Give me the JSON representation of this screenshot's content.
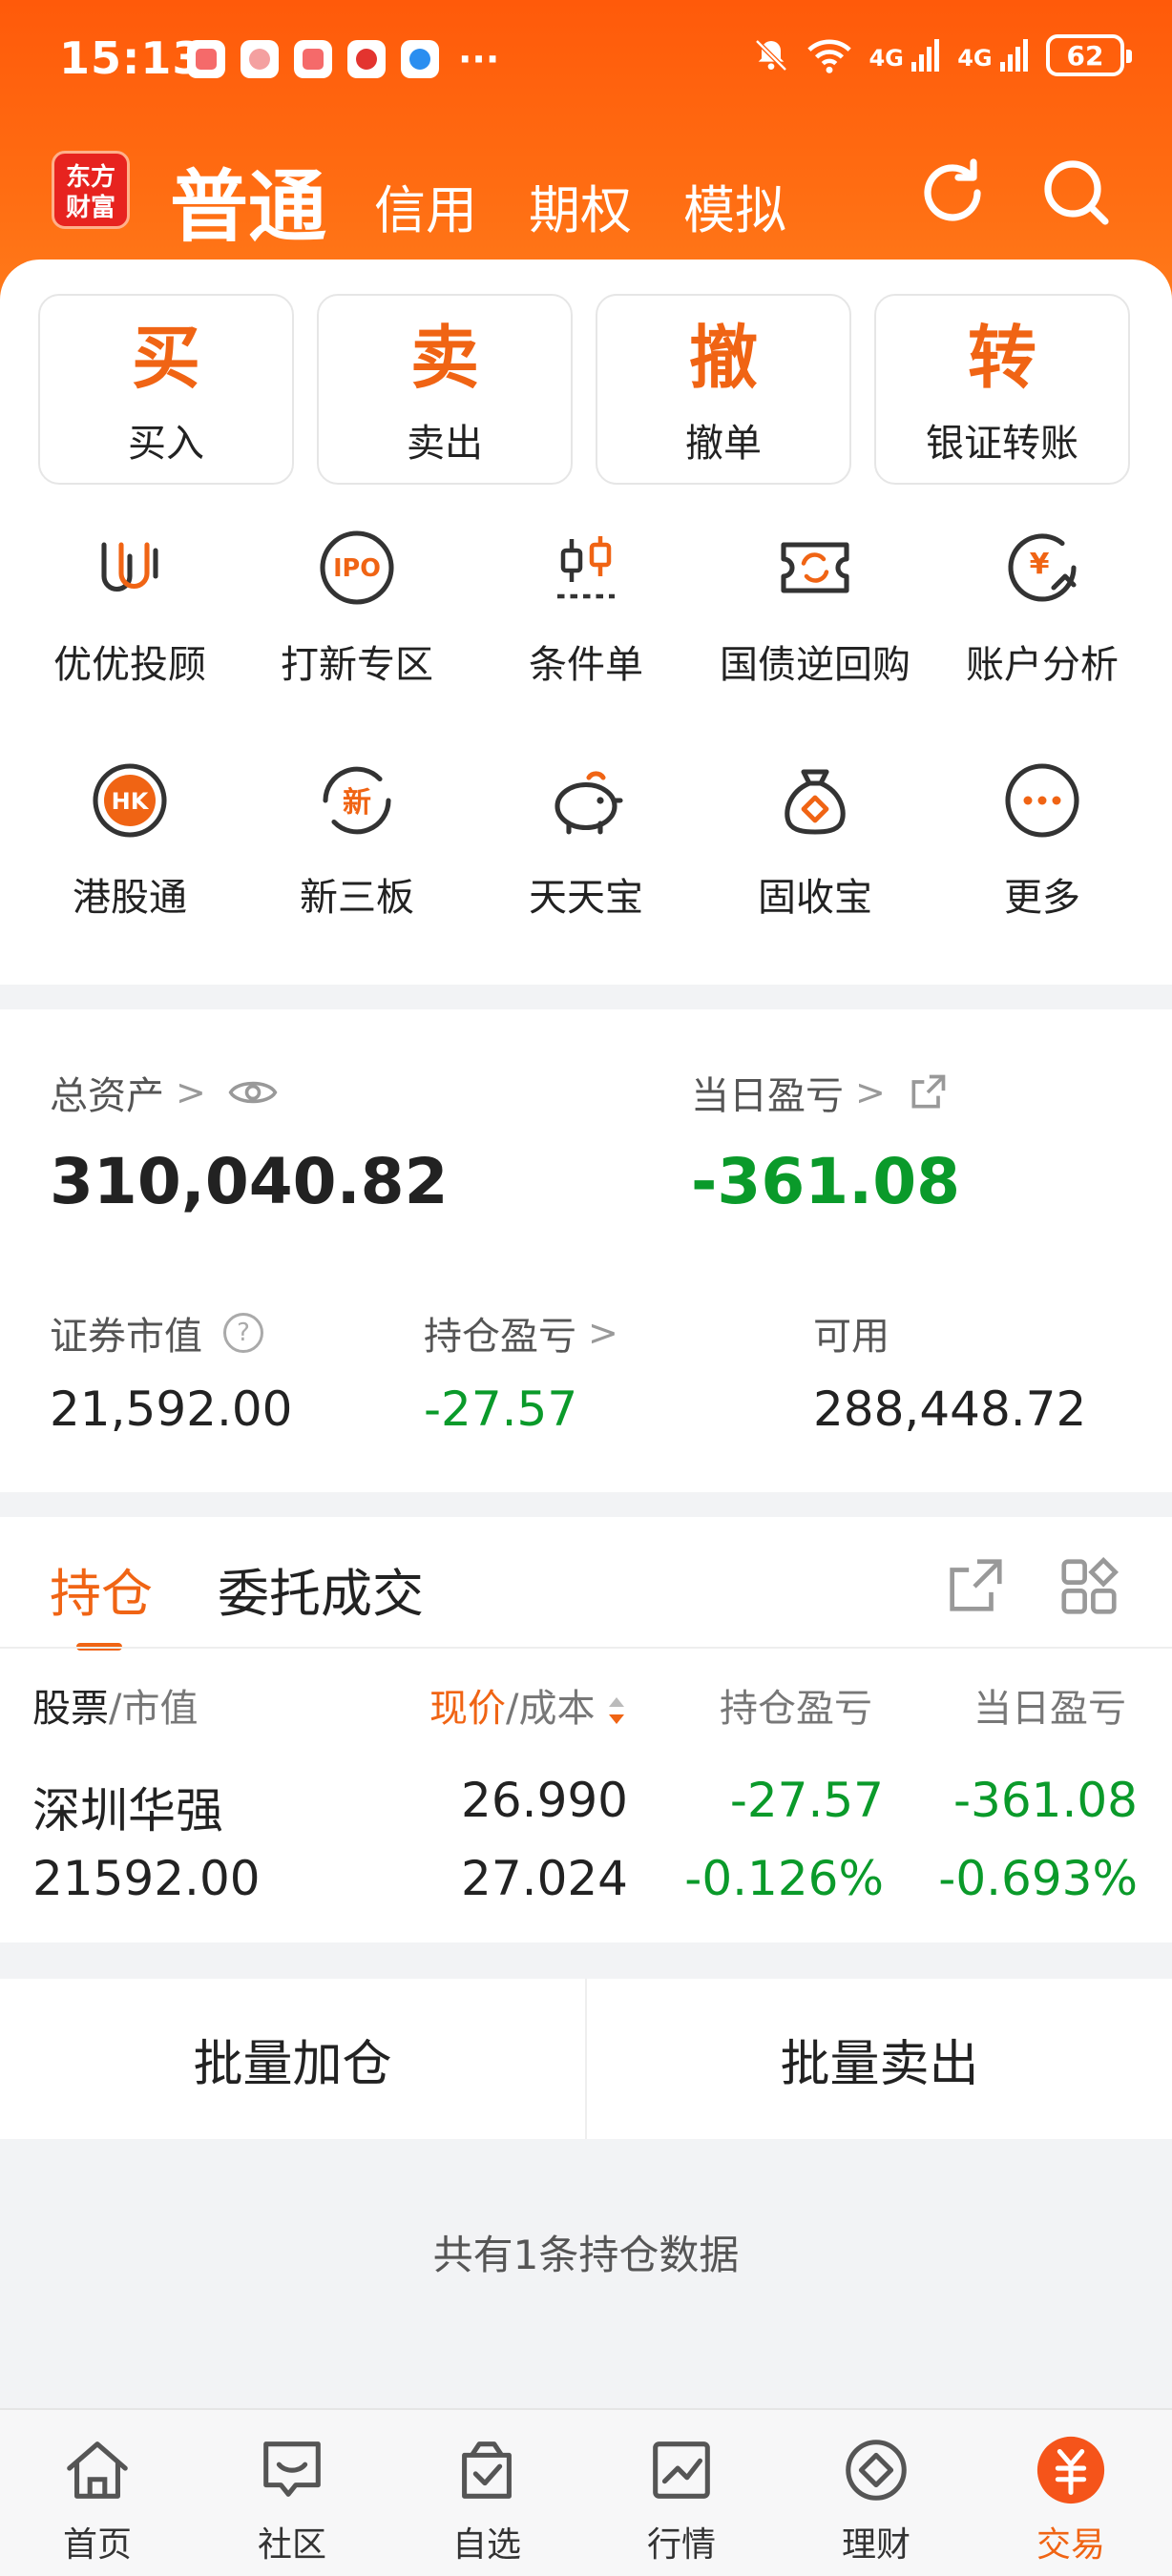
{
  "status_bar": {
    "time": "15:13",
    "more": "···",
    "net1": "4G",
    "net2": "4G",
    "battery": "62"
  },
  "header": {
    "logo_line1": "东方",
    "logo_line2": "财富",
    "tabs": [
      "普通",
      "信用",
      "期权",
      "模拟"
    ],
    "active_tab": "普通"
  },
  "quick_actions": [
    {
      "glyph": "买",
      "label": "买入"
    },
    {
      "glyph": "卖",
      "label": "卖出"
    },
    {
      "glyph": "撤",
      "label": "撤单"
    },
    {
      "glyph": "转",
      "label": "银证转账"
    }
  ],
  "services": [
    {
      "label": "优优投顾",
      "icon": "youyou-icon"
    },
    {
      "label": "打新专区",
      "icon": "ipo-icon",
      "icon_text": "IPO"
    },
    {
      "label": "条件单",
      "icon": "candlestick-icon"
    },
    {
      "label": "国债逆回购",
      "icon": "repo-ticket-icon"
    },
    {
      "label": "账户分析",
      "icon": "account-analysis-icon",
      "icon_text": "¥"
    },
    {
      "label": "港股通",
      "icon": "hk-icon",
      "icon_text": "HK"
    },
    {
      "label": "新三板",
      "icon": "new-board-icon",
      "icon_text": "新"
    },
    {
      "label": "天天宝",
      "icon": "piggy-bank-icon"
    },
    {
      "label": "固收宝",
      "icon": "money-bag-icon"
    },
    {
      "label": "更多",
      "icon": "more-icon"
    }
  ],
  "assets": {
    "total_label": "总资产",
    "total_value": "310,040.82",
    "daily_pl_label": "当日盈亏",
    "daily_pl_value": "-361.08",
    "market_value_label": "证券市值",
    "market_value": "21,592.00",
    "position_pl_label": "持仓盈亏",
    "position_pl_value": "-27.57",
    "available_label": "可用",
    "available_value": "288,448.72",
    "chevron": ">",
    "help": "?"
  },
  "positions": {
    "tabs": [
      "持仓",
      "委托成交"
    ],
    "active_tab": "持仓",
    "headers": {
      "stock_a": "股票",
      "stock_b": "/市值",
      "price_a": "现价",
      "price_b": "/成本",
      "position_pl": "持仓盈亏",
      "daily_pl": "当日盈亏"
    },
    "rows": [
      {
        "name": "深圳华强",
        "market_value": "21592.00",
        "price": "26.990",
        "cost": "27.024",
        "position_pl": "-27.57",
        "position_pl_pct": "-0.126%",
        "daily_pl": "-361.08",
        "daily_pl_pct": "-0.693%"
      }
    ]
  },
  "batch": {
    "add": "批量加仓",
    "sell": "批量卖出"
  },
  "summary": "共有1条持仓数据",
  "bottom_nav": [
    {
      "label": "首页",
      "icon": "home-icon"
    },
    {
      "label": "社区",
      "icon": "community-icon"
    },
    {
      "label": "自选",
      "icon": "watchlist-icon"
    },
    {
      "label": "行情",
      "icon": "market-chart-icon"
    },
    {
      "label": "理财",
      "icon": "wealth-icon"
    },
    {
      "label": "交易",
      "icon": "trade-icon",
      "active": true
    }
  ],
  "colors": {
    "accent": "#f06414",
    "header": "#ff5a0a",
    "loss_green": "#0a9a2a"
  }
}
